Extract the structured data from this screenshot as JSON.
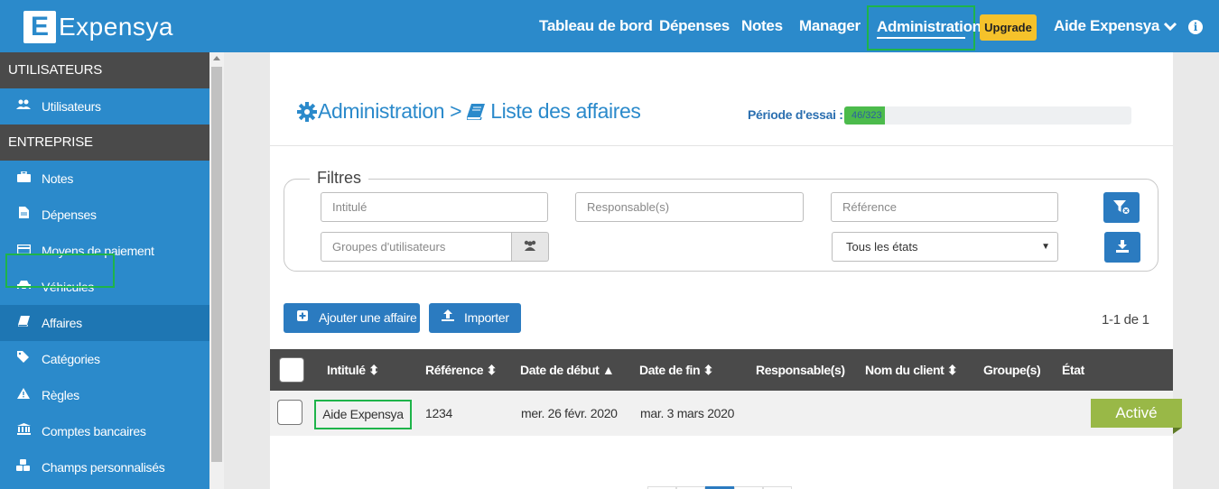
{
  "brand": {
    "logo_letter": "E",
    "name": "Expensya"
  },
  "nav": {
    "items": [
      "Tableau de bord",
      "Dépenses",
      "Notes",
      "Manager"
    ],
    "active": "Administration",
    "upgrade": "Upgrade",
    "user": "Aide Expensya",
    "info": "i"
  },
  "sidebar": {
    "sections": [
      {
        "title": "UTILISATEURS",
        "items": [
          {
            "label": "Utilisateurs",
            "icon": "users-icon"
          }
        ]
      },
      {
        "title": "ENTREPRISE",
        "items": [
          {
            "label": "Notes",
            "icon": "briefcase-icon"
          },
          {
            "label": "Dépenses",
            "icon": "file-icon"
          },
          {
            "label": "Moyens de paiement",
            "icon": "credit-card-icon"
          },
          {
            "label": "Véhicules",
            "icon": "car-icon"
          },
          {
            "label": "Affaires",
            "icon": "book-icon"
          },
          {
            "label": "Catégories",
            "icon": "tags-icon"
          },
          {
            "label": "Règles",
            "icon": "warning-icon"
          },
          {
            "label": "Comptes bancaires",
            "icon": "bank-icon"
          },
          {
            "label": "Champs personnalisés",
            "icon": "cubes-icon"
          }
        ]
      }
    ],
    "active_item": "Affaires"
  },
  "page": {
    "breadcrumb_root": "Administration",
    "breadcrumb_sep": ">",
    "breadcrumb_current": "Liste des affaires",
    "trial_label": "Période d'essai :",
    "trial_progress": "46/323",
    "trial_fraction": 0.142
  },
  "filters": {
    "legend": "Filtres",
    "intitule_placeholder": "Intitulé",
    "responsable_placeholder": "Responsable(s)",
    "reference_placeholder": "Référence",
    "groupes_placeholder": "Groupes d'utilisateurs",
    "etat_selected": "Tous les états"
  },
  "actions": {
    "add": "Ajouter une affaire",
    "import": "Importer",
    "pagination": "1-1 de 1"
  },
  "table": {
    "columns": [
      "Intitulé",
      "Référence",
      "Date de début",
      "Date de fin",
      "Responsable(s)",
      "Nom du client",
      "Groupe(s)",
      "État"
    ],
    "rows": [
      {
        "intitule": "Aide Expensya",
        "reference": "1234",
        "date_debut": "mer. 26 févr. 2020",
        "date_fin": "mar. 3 mars 2020",
        "etat": "Activé"
      }
    ]
  },
  "colors": {
    "brand_blue": "#2b8acb",
    "highlight_green": "#1eb44a",
    "status_green": "#99b847",
    "upgrade_yellow": "#f5c22b"
  }
}
